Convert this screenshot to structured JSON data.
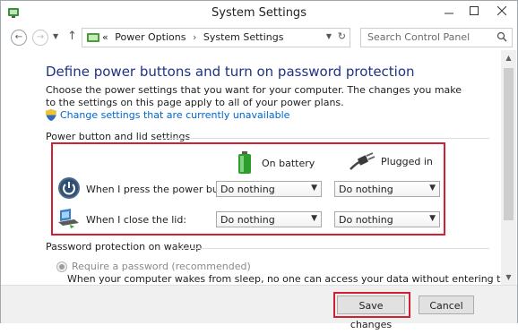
{
  "window": {
    "title": "System Settings"
  },
  "nav": {
    "breadcrumb": [
      "Power Options",
      "System Settings"
    ],
    "breadcrumb_prefix": "«",
    "breadcrumb_separator": "›",
    "search_placeholder": "Search Control Panel"
  },
  "main": {
    "heading": "Define power buttons and turn on password protection",
    "description": "Choose the power settings that you want for your computer. The changes you make to the settings on this page apply to all of your power plans.",
    "change_link": "Change settings that are currently unavailable",
    "power_group_label": "Power button and lid settings",
    "columns": {
      "battery": "On battery",
      "plugged": "Plugged in"
    },
    "rows": [
      {
        "label": "When I press the power button:",
        "battery": "Do nothing",
        "plugged": "Do nothing"
      },
      {
        "label": "When I close the lid:",
        "battery": "Do nothing",
        "plugged": "Do nothing"
      }
    ],
    "password_group_label": "Password protection on wakeup",
    "require_password_label": "Require a password (recommended)",
    "require_password_desc": "When your computer wakes from sleep, no one can access your data without entering the correct"
  },
  "footer": {
    "save_label": "Save changes",
    "cancel_label": "Cancel"
  },
  "colors": {
    "highlight_red": "#d11f33",
    "heading_blue": "#1e3287",
    "link_blue": "#0066cc"
  }
}
